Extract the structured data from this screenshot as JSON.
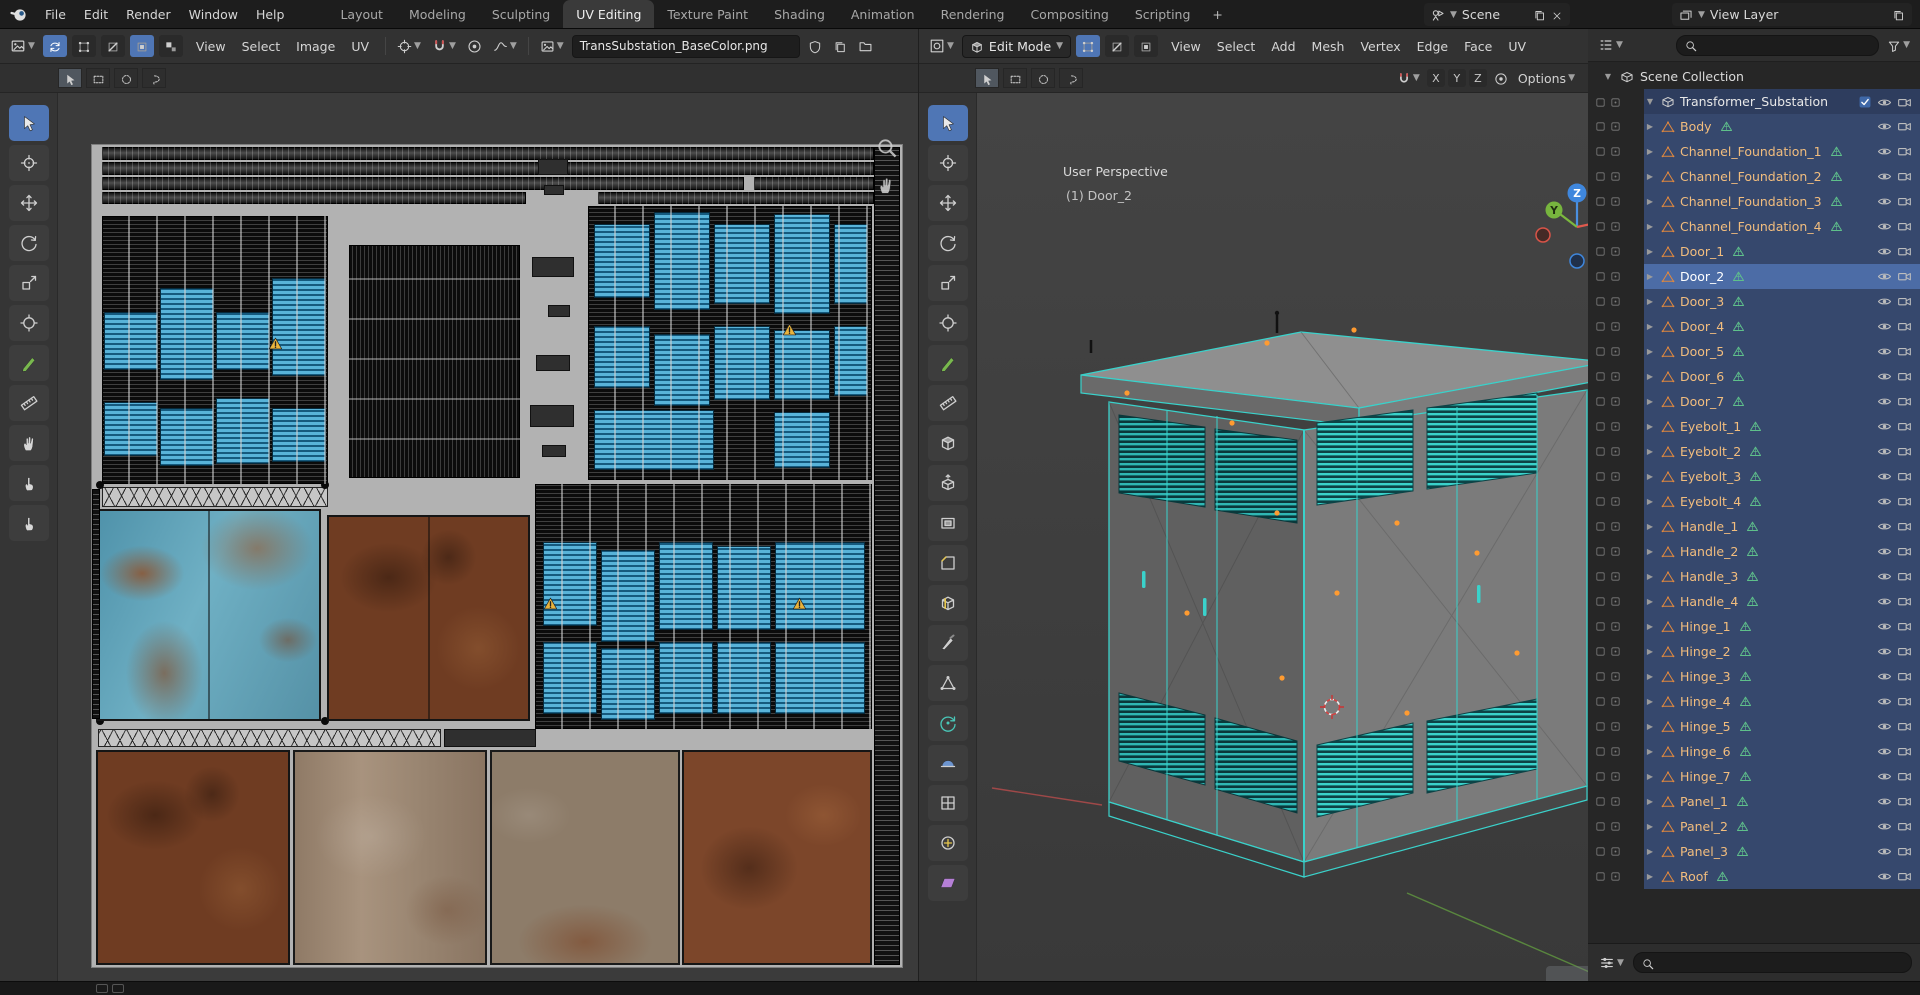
{
  "topbar": {
    "menus": [
      "File",
      "Edit",
      "Render",
      "Window",
      "Help"
    ],
    "tabs": [
      "Layout",
      "Modeling",
      "Sculpting",
      "UV Editing",
      "Texture Paint",
      "Shading",
      "Animation",
      "Rendering",
      "Compositing",
      "Scripting"
    ],
    "active_tab": "UV Editing",
    "new_tab_label": "+",
    "scene_selector": {
      "value": "Scene"
    },
    "view_layer_selector": {
      "value": "View Layer"
    }
  },
  "uv_editor": {
    "menus": [
      "View",
      "Select",
      "Image",
      "UV"
    ],
    "image_name": "TransSubstation_BaseColor.png",
    "tools": [
      "tweak",
      "cursor",
      "move",
      "rotate",
      "scale",
      "transform",
      "annotate",
      "measure",
      "grab",
      "relax",
      "pinch"
    ]
  },
  "viewport": {
    "editor_mode": "Edit Mode",
    "menus": [
      "View",
      "Select",
      "Add",
      "Mesh",
      "Vertex",
      "Edge",
      "Face",
      "UV"
    ],
    "overlay_perspective": "User Perspective",
    "overlay_active_object": "(1) Door_2",
    "axis_toggles": [
      "X",
      "Y",
      "Z"
    ],
    "options_label": "Options",
    "gizmo": {
      "x": "X",
      "y": "Y",
      "z": "Z"
    },
    "tools": [
      "tweak",
      "cursor",
      "move",
      "rotate",
      "scale",
      "transform",
      "annotate",
      "measure",
      "add-cube",
      "extrude-region",
      "inset-faces",
      "bevel",
      "loop-cut",
      "knife",
      "poly-build",
      "spin",
      "smooth",
      "edge-slide",
      "shrink-flatten",
      "shear"
    ]
  },
  "outliner": {
    "scene_collection_label": "Scene Collection",
    "collection": {
      "name": "Transformer_Substation",
      "checked": true
    },
    "objects": [
      "Body",
      "Channel_Foundation_1",
      "Channel_Foundation_2",
      "Channel_Foundation_3",
      "Channel_Foundation_4",
      "Door_1",
      "Door_2",
      "Door_3",
      "Door_4",
      "Door_5",
      "Door_6",
      "Door_7",
      "Eyebolt_1",
      "Eyebolt_2",
      "Eyebolt_3",
      "Eyebolt_4",
      "Handle_1",
      "Handle_2",
      "Handle_3",
      "Handle_4",
      "Hinge_1",
      "Hinge_2",
      "Hinge_3",
      "Hinge_4",
      "Hinge_5",
      "Hinge_6",
      "Hinge_7",
      "Panel_1",
      "Panel_2",
      "Panel_3",
      "Roof"
    ],
    "active_object": "Door_2"
  },
  "colors": {
    "accent": "#4f76b5",
    "selected_row": "#36486d",
    "active_row": "#4c6ca6",
    "object_name": "#f2bd7e",
    "mesh_icon": "#e0883f",
    "mesh_data_icon": "#5fc08b",
    "uv_blue": "#58b3d9",
    "rust": "#6f3c22",
    "wire_highlight": "#3ad2cb"
  }
}
